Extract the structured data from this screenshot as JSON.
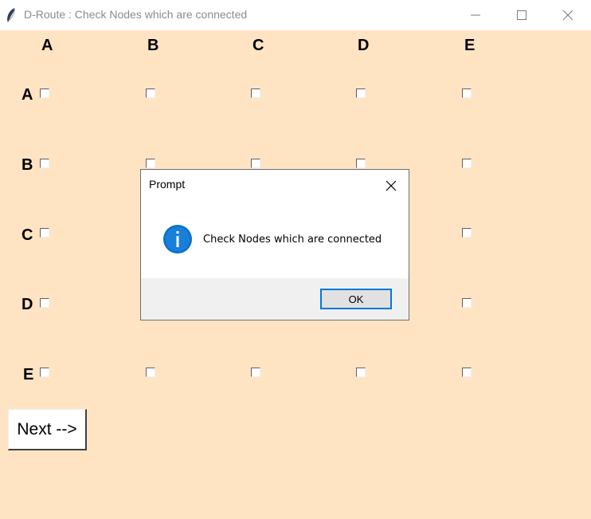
{
  "window": {
    "title": "D-Route : Check Nodes which are connected",
    "app_icon": "feather-icon",
    "controls": [
      "minimize-icon",
      "maximize-icon",
      "close-icon"
    ]
  },
  "grid": {
    "columns": [
      "A",
      "B",
      "C",
      "D",
      "E"
    ],
    "rows": [
      "A",
      "B",
      "C",
      "D",
      "E"
    ],
    "checked": [
      [
        false,
        false,
        false,
        false,
        false
      ],
      [
        false,
        false,
        false,
        false,
        false
      ],
      [
        false,
        false,
        false,
        false,
        false
      ],
      [
        false,
        false,
        false,
        false,
        false
      ],
      [
        false,
        false,
        false,
        false,
        false
      ]
    ]
  },
  "next_button": {
    "label": "Next -->"
  },
  "dialog": {
    "title": "Prompt",
    "icon": "info-icon",
    "message": "Check Nodes which are connected",
    "ok_label": "OK"
  },
  "colors": {
    "background": "#ffe4c4",
    "accent": "#0078d7"
  }
}
